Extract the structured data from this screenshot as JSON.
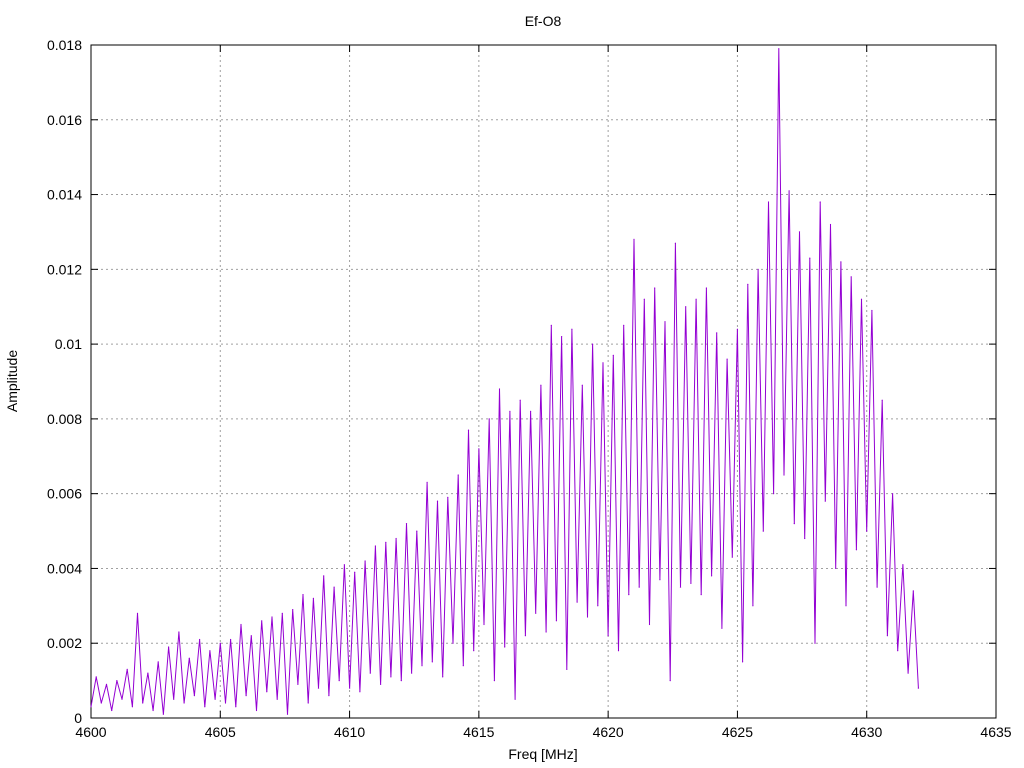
{
  "chart_data": {
    "type": "line",
    "title": "Ef-O8",
    "xlabel": "Freq [MHz]",
    "ylabel": "Amplitude",
    "xlim": [
      4600,
      4635
    ],
    "ylim": [
      0,
      0.018
    ],
    "grid": true,
    "legend": "none",
    "xticks": [
      4600,
      4605,
      4610,
      4615,
      4620,
      4625,
      4630,
      4635
    ],
    "xtick_labels": [
      "4600",
      "4605",
      "4610",
      "4615",
      "4620",
      "4625",
      "4630",
      "4635"
    ],
    "yticks": [
      0,
      0.002,
      0.004,
      0.006,
      0.008,
      0.01,
      0.012,
      0.014,
      0.016,
      0.018
    ],
    "ytick_labels": [
      "0",
      "0.002",
      "0.004",
      "0.006",
      "0.008",
      "0.01",
      "0.012",
      "0.014",
      "0.016",
      "0.018"
    ],
    "series": [
      {
        "color": "#9400d3",
        "x": [
          4600.0,
          4600.2,
          4600.4,
          4600.6,
          4600.8,
          4601.0,
          4601.2,
          4601.4,
          4601.6,
          4601.8,
          4602.0,
          4602.2,
          4602.4,
          4602.6,
          4602.8,
          4603.0,
          4603.2,
          4603.4,
          4603.6,
          4603.8,
          4604.0,
          4604.2,
          4604.4,
          4604.6,
          4604.8,
          4605.0,
          4605.2,
          4605.4,
          4605.6,
          4605.8,
          4606.0,
          4606.2,
          4606.4,
          4606.6,
          4606.8,
          4607.0,
          4607.2,
          4607.4,
          4607.6,
          4607.8,
          4608.0,
          4608.2,
          4608.4,
          4608.6,
          4608.8,
          4609.0,
          4609.2,
          4609.4,
          4609.6,
          4609.8,
          4610.0,
          4610.2,
          4610.4,
          4610.6,
          4610.8,
          4611.0,
          4611.2,
          4611.4,
          4611.6,
          4611.8,
          4612.0,
          4612.2,
          4612.4,
          4612.6,
          4612.8,
          4613.0,
          4613.2,
          4613.4,
          4613.6,
          4613.8,
          4614.0,
          4614.2,
          4614.4,
          4614.6,
          4614.8,
          4615.0,
          4615.2,
          4615.4,
          4615.6,
          4615.8,
          4616.0,
          4616.2,
          4616.4,
          4616.6,
          4616.8,
          4617.0,
          4617.2,
          4617.4,
          4617.6,
          4617.8,
          4618.0,
          4618.2,
          4618.4,
          4618.6,
          4618.8,
          4619.0,
          4619.2,
          4619.4,
          4619.6,
          4619.8,
          4620.0,
          4620.2,
          4620.4,
          4620.6,
          4620.8,
          4621.0,
          4621.2,
          4621.4,
          4621.6,
          4621.8,
          4622.0,
          4622.2,
          4622.4,
          4622.6,
          4622.8,
          4623.0,
          4623.2,
          4623.4,
          4623.6,
          4623.8,
          4624.0,
          4624.2,
          4624.4,
          4624.6,
          4624.8,
          4625.0,
          4625.2,
          4625.4,
          4625.6,
          4625.8,
          4626.0,
          4626.2,
          4626.4,
          4626.6,
          4626.8,
          4627.0,
          4627.2,
          4627.4,
          4627.6,
          4627.8,
          4628.0,
          4628.2,
          4628.4,
          4628.6,
          4628.8,
          4629.0,
          4629.2,
          4629.4,
          4629.6,
          4629.8,
          4630.0,
          4630.2,
          4630.4,
          4630.6,
          4630.8,
          4631.0,
          4631.2,
          4631.4,
          4631.6,
          4631.8,
          4632.0
        ],
        "y": [
          0.0003,
          0.0011,
          0.0004,
          0.0009,
          0.0002,
          0.001,
          0.0005,
          0.0013,
          0.0003,
          0.0028,
          0.0004,
          0.0012,
          0.0002,
          0.0015,
          0.0001,
          0.0019,
          0.0005,
          0.0023,
          0.0004,
          0.0016,
          0.0006,
          0.0021,
          0.0003,
          0.0018,
          0.0005,
          0.002,
          0.0004,
          0.0021,
          0.0003,
          0.0025,
          0.0006,
          0.0022,
          0.0002,
          0.0026,
          0.0007,
          0.0027,
          0.0005,
          0.0028,
          0.0001,
          0.0029,
          0.0009,
          0.0033,
          0.0004,
          0.0032,
          0.0008,
          0.0038,
          0.0006,
          0.0035,
          0.001,
          0.0041,
          0.0008,
          0.0039,
          0.0007,
          0.0042,
          0.0012,
          0.0046,
          0.0009,
          0.0047,
          0.0011,
          0.0048,
          0.001,
          0.0052,
          0.0012,
          0.005,
          0.0014,
          0.0063,
          0.0015,
          0.0058,
          0.0011,
          0.0059,
          0.002,
          0.0065,
          0.0014,
          0.0077,
          0.0018,
          0.0072,
          0.0025,
          0.008,
          0.001,
          0.0088,
          0.0019,
          0.0082,
          0.0005,
          0.0085,
          0.0022,
          0.0082,
          0.0028,
          0.0089,
          0.0023,
          0.0105,
          0.0026,
          0.0102,
          0.0013,
          0.0104,
          0.0031,
          0.0089,
          0.0027,
          0.01,
          0.003,
          0.0095,
          0.0022,
          0.0097,
          0.0018,
          0.0105,
          0.0033,
          0.0128,
          0.0035,
          0.0112,
          0.0025,
          0.0115,
          0.0037,
          0.0106,
          0.001,
          0.0127,
          0.0035,
          0.011,
          0.0036,
          0.0112,
          0.0033,
          0.0115,
          0.0038,
          0.0103,
          0.0024,
          0.0096,
          0.0043,
          0.0104,
          0.0015,
          0.0116,
          0.003,
          0.012,
          0.005,
          0.0138,
          0.006,
          0.0179,
          0.0065,
          0.0141,
          0.0052,
          0.013,
          0.0048,
          0.0123,
          0.002,
          0.0138,
          0.0058,
          0.0132,
          0.004,
          0.0122,
          0.003,
          0.0118,
          0.0045,
          0.0112,
          0.005,
          0.0109,
          0.0035,
          0.0085,
          0.0022,
          0.006,
          0.0018,
          0.0041,
          0.0012,
          0.0034,
          0.0008
        ]
      }
    ]
  }
}
